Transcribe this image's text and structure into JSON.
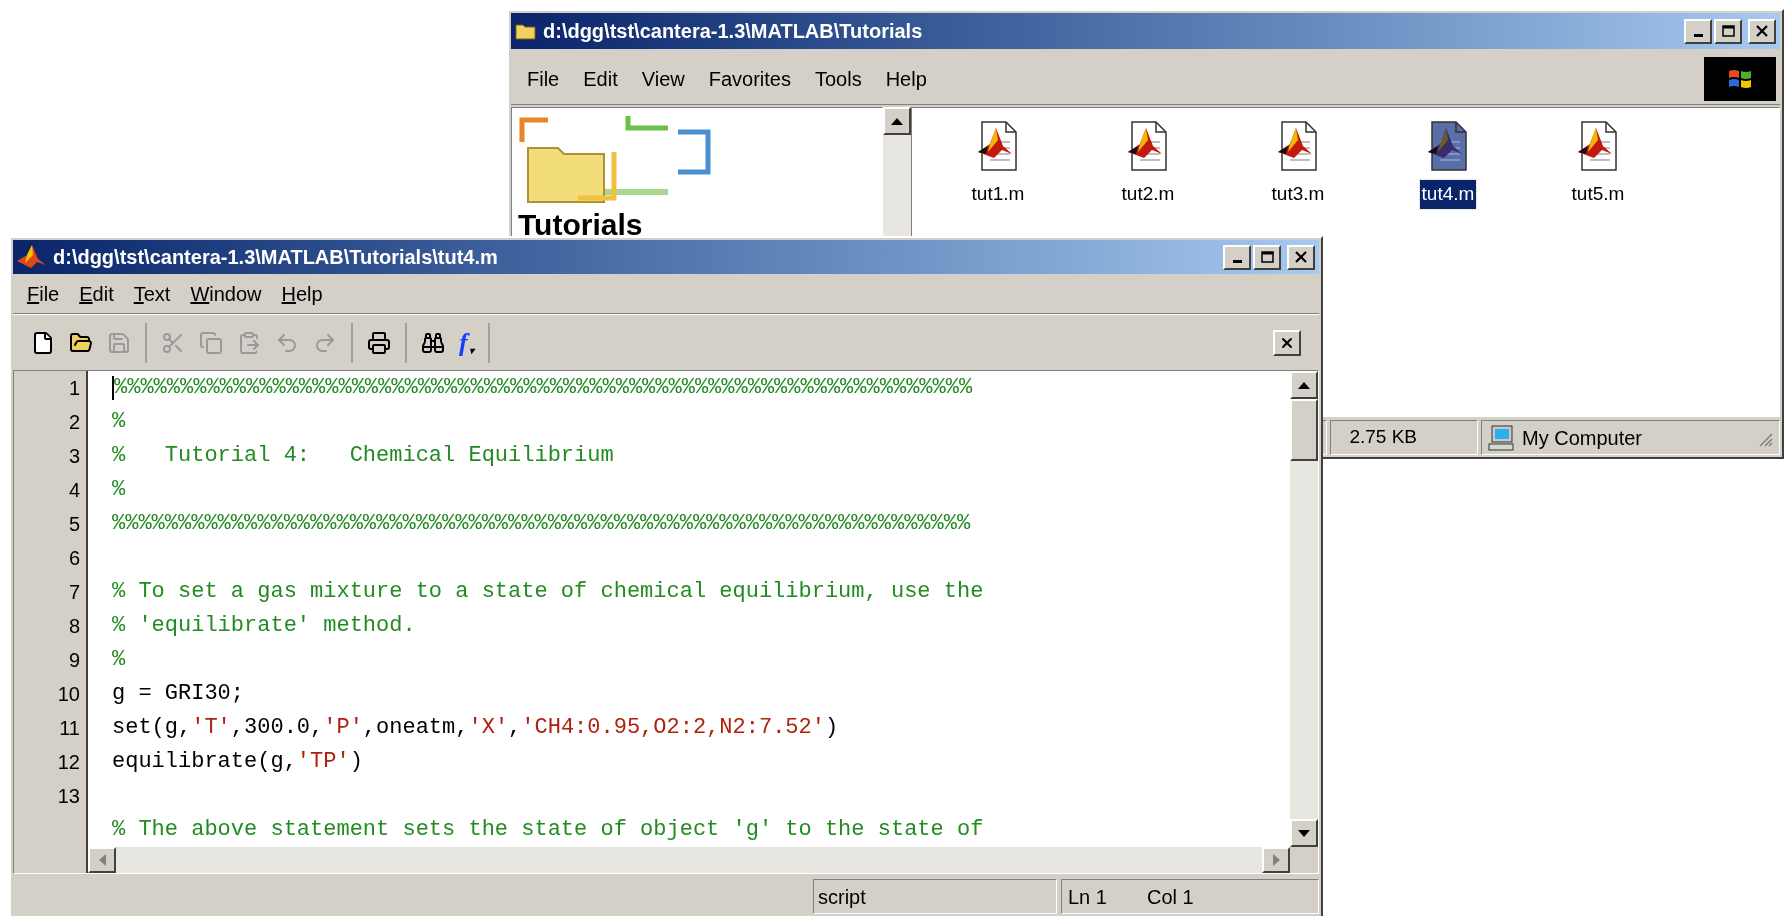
{
  "explorer": {
    "title": "d:\\dgg\\tst\\cantera-1.3\\MATLAB\\Tutorials",
    "menu": [
      "File",
      "Edit",
      "View",
      "Favorites",
      "Tools",
      "Help"
    ],
    "folder_pane": {
      "heading": "Tutorials"
    },
    "files": [
      {
        "name": "tut1.m",
        "selected": false
      },
      {
        "name": "tut2.m",
        "selected": false
      },
      {
        "name": "tut3.m",
        "selected": false
      },
      {
        "name": "tut4.m",
        "selected": true
      },
      {
        "name": "tut5.m",
        "selected": false
      }
    ],
    "status_bar": {
      "size": "2.75 KB",
      "zone": "My Computer"
    }
  },
  "editor": {
    "title": "d:\\dgg\\tst\\cantera-1.3\\MATLAB\\Tutorials\\tut4.m",
    "menu": [
      "File",
      "Edit",
      "Text",
      "Window",
      "Help"
    ],
    "toolbar": [
      [
        {
          "kind": "new",
          "disabled": false
        },
        {
          "kind": "open",
          "disabled": false
        },
        {
          "kind": "save",
          "disabled": true
        }
      ],
      [
        {
          "kind": "cut",
          "disabled": true
        },
        {
          "kind": "copy",
          "disabled": true
        },
        {
          "kind": "paste",
          "disabled": true
        },
        {
          "kind": "undo",
          "disabled": true
        },
        {
          "kind": "redo",
          "disabled": true
        }
      ],
      [
        {
          "kind": "print",
          "disabled": false
        }
      ],
      [
        {
          "kind": "find",
          "disabled": false
        },
        {
          "kind": "function",
          "disabled": false,
          "label": "f",
          "dropdown_marker": "▾"
        }
      ]
    ],
    "lines": [
      {
        "number": "1",
        "cursor": true,
        "segments": [
          {
            "kind": "comment",
            "text": "%%%%%%%%%%%%%%%%%%%%%%%%%%%%%%%%%%%%%%%%%%%%%%%%%%%%%%%%%%%%%%%%%"
          }
        ]
      },
      {
        "number": "2",
        "cursor": false,
        "segments": [
          {
            "kind": "comment",
            "text": "%"
          }
        ]
      },
      {
        "number": "3",
        "cursor": false,
        "segments": [
          {
            "kind": "comment",
            "text": "%   Tutorial 4:   Chemical Equilibrium"
          }
        ]
      },
      {
        "number": "4",
        "cursor": false,
        "segments": [
          {
            "kind": "comment",
            "text": "%"
          }
        ]
      },
      {
        "number": "5",
        "cursor": false,
        "segments": [
          {
            "kind": "comment",
            "text": "%%%%%%%%%%%%%%%%%%%%%%%%%%%%%%%%%%%%%%%%%%%%%%%%%%%%%%%%%%%%%%%%%"
          }
        ]
      },
      {
        "number": "6",
        "cursor": false
      },
      {
        "number": "7",
        "cursor": false,
        "segments": [
          {
            "kind": "comment",
            "text": "% To set a gas mixture to a state of chemical equilibrium, use the"
          }
        ]
      },
      {
        "number": "8",
        "cursor": false,
        "segments": [
          {
            "kind": "comment",
            "text": "% 'equilibrate' method."
          }
        ]
      },
      {
        "number": "9",
        "cursor": false,
        "segments": [
          {
            "kind": "comment",
            "text": "%"
          }
        ]
      },
      {
        "number": "10",
        "cursor": false,
        "segments": [
          {
            "kind": "code",
            "text": "g = GRI30;"
          }
        ]
      },
      {
        "number": "11",
        "cursor": false,
        "segments": [
          {
            "kind": "code",
            "text": "set(g,"
          },
          {
            "kind": "string",
            "text": "'T'"
          },
          {
            "kind": "code",
            "text": ",300.0,"
          },
          {
            "kind": "string",
            "text": "'P'"
          },
          {
            "kind": "code",
            "text": ",oneatm,"
          },
          {
            "kind": "string",
            "text": "'X'"
          },
          {
            "kind": "code",
            "text": ","
          },
          {
            "kind": "string",
            "text": "'CH4:0.95,O2:2,N2:7.52'"
          },
          {
            "kind": "code",
            "text": ")"
          }
        ]
      },
      {
        "number": "12",
        "cursor": false,
        "segments": [
          {
            "kind": "code",
            "text": "equilibrate(g,"
          },
          {
            "kind": "string",
            "text": "'TP'"
          },
          {
            "kind": "code",
            "text": ")"
          }
        ]
      },
      {
        "number": "13",
        "cursor": false
      },
      {
        "cursor": false,
        "segments": [
          {
            "kind": "comment",
            "text": "% The above statement sets the state of object 'g' to the state of"
          }
        ]
      }
    ],
    "status_bar": {
      "mode": "script",
      "line": "Ln 1",
      "column": "Col 1"
    }
  }
}
